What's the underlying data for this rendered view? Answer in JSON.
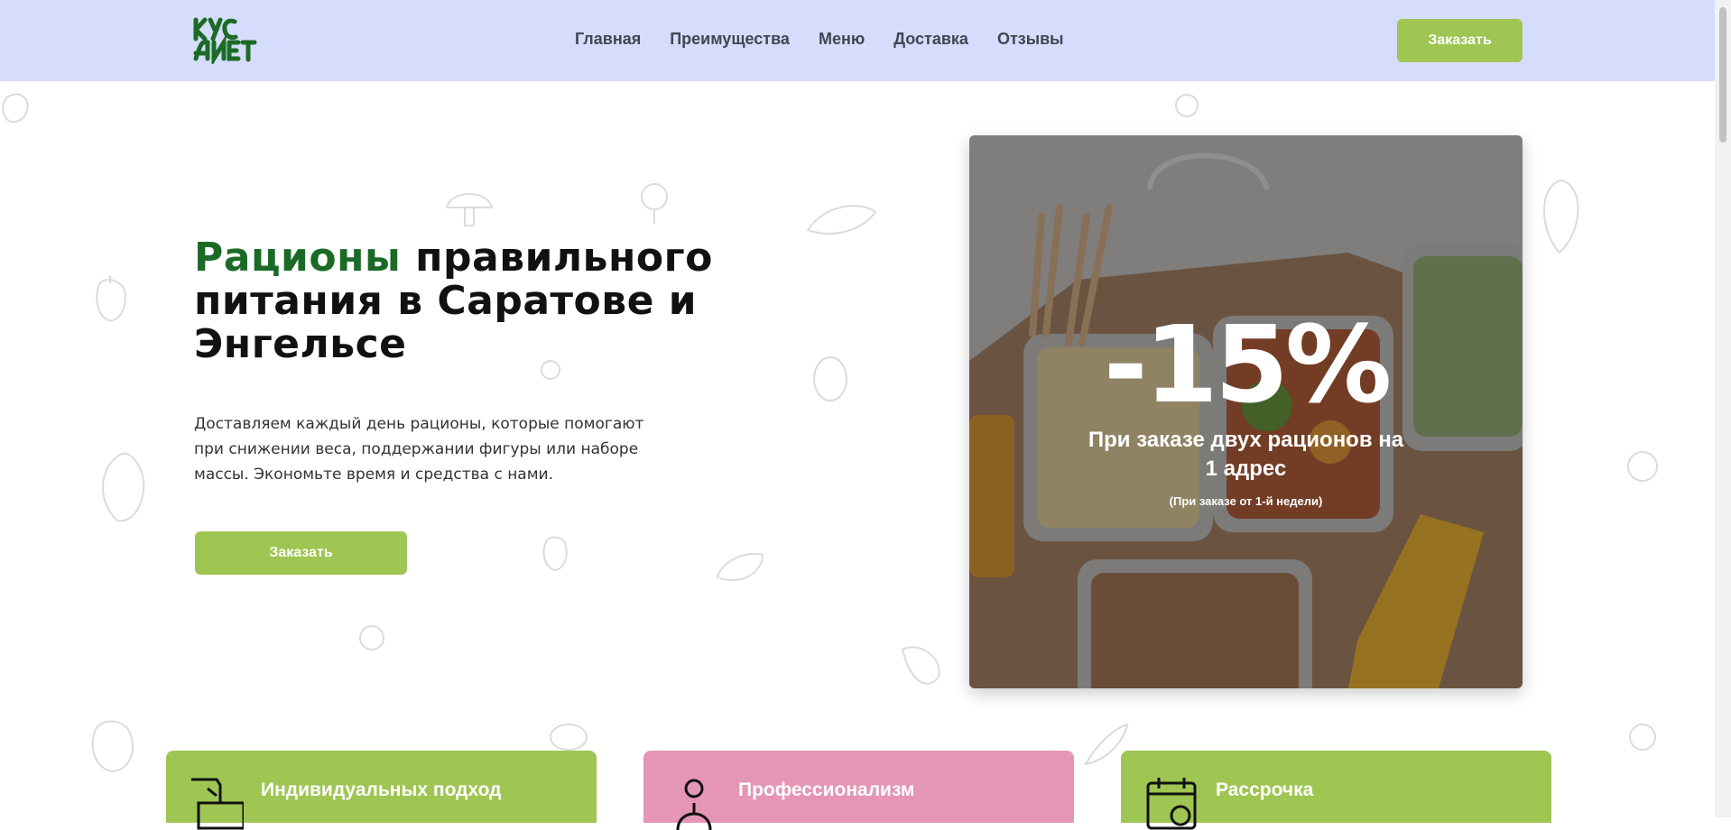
{
  "header": {
    "logo_text": "КУС ДИЕТ",
    "nav": [
      "Главная",
      "Преимущества",
      "Меню",
      "Доставка",
      "Отзывы"
    ],
    "order_label": "Заказать"
  },
  "hero": {
    "title_accent": "Рационы",
    "title_rest": "правильного питания в Саратове и Энгельсе",
    "description": "Доставляем каждый день рационы, которые помогают при снижении веса, поддержании фигуры или наборе массы. Экономьте время и средства с нами.",
    "order_label": "Заказать"
  },
  "promo": {
    "discount": "-15%",
    "text": "При заказе двух рационов на 1 адрес",
    "note": "(При заказе от 1-й недели)"
  },
  "features": [
    {
      "title": "Индивидуальных подход",
      "icon": "hand-card-icon"
    },
    {
      "title": "Профессионализм",
      "icon": "professional-person-icon"
    },
    {
      "title": "Рассрочка",
      "icon": "calendar-coin-icon"
    }
  ],
  "colors": {
    "header_bg": "#d6dcfb",
    "accent_green": "#9fc552",
    "dark_green": "#1b6b26",
    "pink": "#e596b4"
  }
}
